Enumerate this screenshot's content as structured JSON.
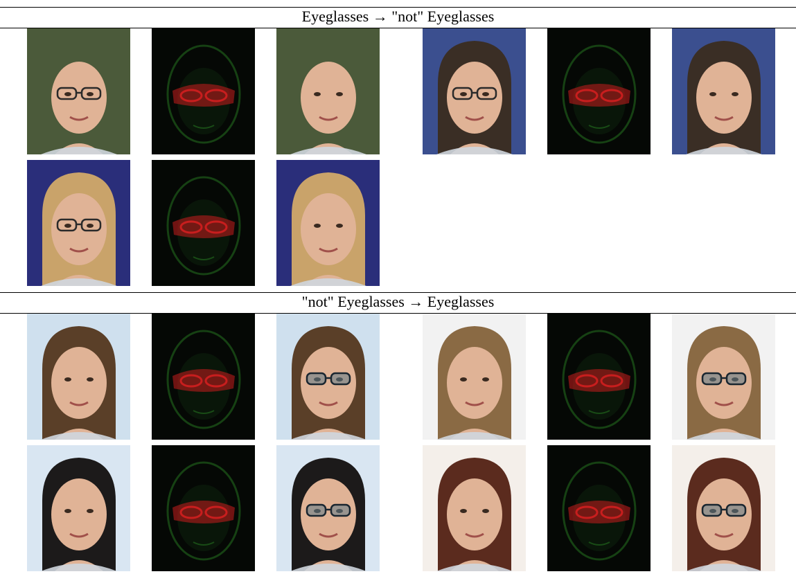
{
  "sections": [
    {
      "title_source": "Eyeglasses",
      "title_arrow": "→",
      "title_target": "\"not\" Eyeglasses",
      "rows": [
        [
          {
            "kind": "photo",
            "subject": "bald-man-glasses",
            "bg": "#4b5a3a"
          },
          {
            "kind": "diff",
            "subject": "bald-man-glasses"
          },
          {
            "kind": "edited",
            "subject": "bald-man-glasses",
            "bg": "#4b5a3a"
          },
          {
            "kind": "photo",
            "subject": "smiling-man-blue",
            "bg": "#3b4f8f"
          },
          {
            "kind": "diff",
            "subject": "smiling-man-blue"
          },
          {
            "kind": "edited",
            "subject": "smiling-man-blue",
            "bg": "#3b4f8f"
          }
        ],
        [
          {
            "kind": "photo",
            "subject": "blonde-woman-glasses",
            "bg": "#2a2e7a"
          },
          {
            "kind": "diff",
            "subject": "blonde-woman-glasses"
          },
          {
            "kind": "edited",
            "subject": "blonde-woman-glasses",
            "bg": "#2a2e7a"
          }
        ]
      ]
    },
    {
      "title_source": "\"not\" Eyeglasses",
      "title_arrow": "→",
      "title_target": "Eyeglasses",
      "rows": [
        [
          {
            "kind": "photo",
            "subject": "brunette-woman",
            "bg": "#cfe0ee"
          },
          {
            "kind": "diff",
            "subject": "brunette-woman"
          },
          {
            "kind": "edited",
            "subject": "brunette-woman",
            "bg": "#cfe0ee"
          },
          {
            "kind": "photo",
            "subject": "smiling-woman-light",
            "bg": "#f2f2f2"
          },
          {
            "kind": "diff",
            "subject": "smiling-woman-light"
          },
          {
            "kind": "edited",
            "subject": "smiling-woman-light",
            "bg": "#f2f2f2"
          }
        ],
        [
          {
            "kind": "photo",
            "subject": "man-dark-hair",
            "bg": "#d9e6f2"
          },
          {
            "kind": "diff",
            "subject": "man-dark-hair"
          },
          {
            "kind": "edited",
            "subject": "man-dark-hair",
            "bg": "#d9e6f2"
          },
          {
            "kind": "photo",
            "subject": "woman-hands-hair",
            "bg": "#f4efea"
          },
          {
            "kind": "diff",
            "subject": "woman-hands-hair"
          },
          {
            "kind": "edited",
            "subject": "woman-hands-hair",
            "bg": "#f4efea"
          }
        ]
      ]
    }
  ],
  "colors": {
    "diff_background": "#050805",
    "diff_green": "#1e5a1a",
    "diff_red": "#c81e1e",
    "rule": "#000000"
  }
}
